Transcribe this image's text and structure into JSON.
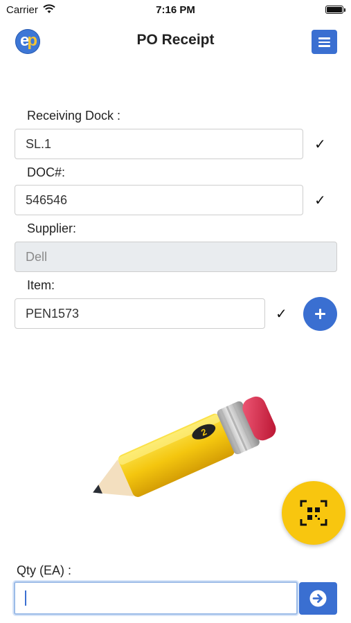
{
  "status_bar": {
    "carrier": "Carrier",
    "time": "7:16 PM"
  },
  "header": {
    "logo_text_e": "e",
    "logo_text_p": "p",
    "title": "PO Receipt"
  },
  "form": {
    "receiving_dock": {
      "label": "Receiving Dock :",
      "value": "SL.1",
      "validated": true
    },
    "doc": {
      "label": "DOC#:",
      "value": "546546",
      "validated": true
    },
    "supplier": {
      "label": "Supplier:",
      "value": "Dell",
      "disabled": true
    },
    "item": {
      "label": "Item:",
      "value": "PEN1573",
      "validated": true
    },
    "qty": {
      "label": "Qty (EA) :",
      "value": ""
    }
  },
  "icons": {
    "check": "✓",
    "menu": "hamburger-icon",
    "add": "plus-icon",
    "scan": "qr-scan-icon",
    "submit": "arrow-right-circle-icon"
  },
  "colors": {
    "primary": "#3a6fd1",
    "scan_fab": "#f8c60f",
    "disabled_field": "#e9ecef"
  }
}
